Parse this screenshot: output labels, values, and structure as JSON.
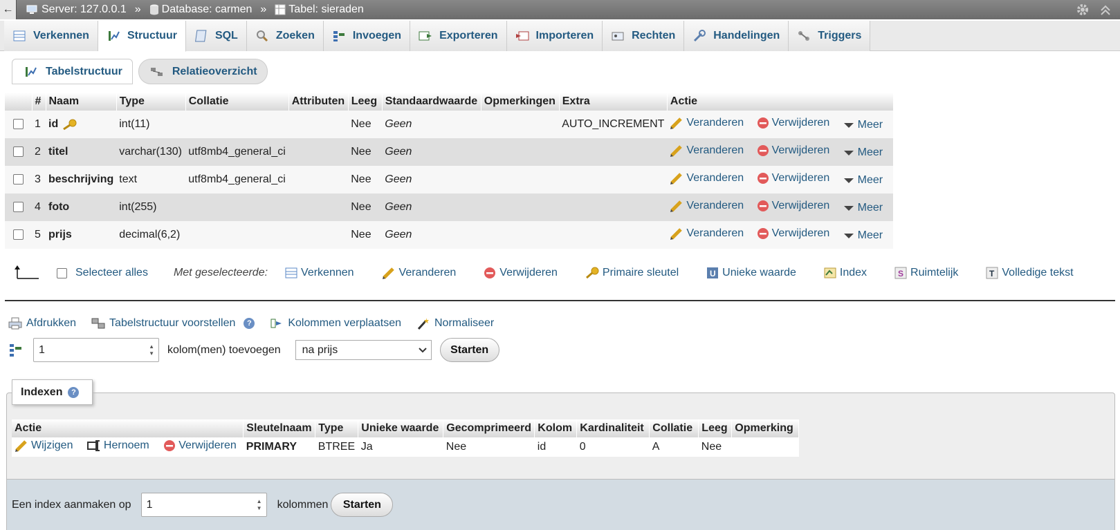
{
  "topbar": {
    "back": "←",
    "server": "Server: 127.0.0.1",
    "database": "Database: carmen",
    "table": "Tabel: sieraden",
    "sep": "»"
  },
  "tabs": [
    {
      "label": "Verkennen",
      "icon": "browse-icon"
    },
    {
      "label": "Structuur",
      "icon": "structure-icon"
    },
    {
      "label": "SQL",
      "icon": "sql-icon"
    },
    {
      "label": "Zoeken",
      "icon": "search-icon"
    },
    {
      "label": "Invoegen",
      "icon": "insert-icon"
    },
    {
      "label": "Exporteren",
      "icon": "export-icon"
    },
    {
      "label": "Importeren",
      "icon": "import-icon"
    },
    {
      "label": "Rechten",
      "icon": "privileges-icon"
    },
    {
      "label": "Handelingen",
      "icon": "wrench-icon"
    },
    {
      "label": "Triggers",
      "icon": "triggers-icon"
    }
  ],
  "subtabs": {
    "table_structure": "Tabelstructuur",
    "relation_view": "Relatieoverzicht"
  },
  "structure": {
    "headers": [
      "#",
      "Naam",
      "Type",
      "Collatie",
      "Attributen",
      "Leeg",
      "Standaardwaarde",
      "Opmerkingen",
      "Extra",
      "Actie"
    ],
    "rows": [
      {
        "num": "1",
        "name": "id",
        "type": "int(11)",
        "collation": "",
        "attributes": "",
        "null": "Nee",
        "default": "Geen",
        "comments": "",
        "extra": "AUTO_INCREMENT"
      },
      {
        "num": "2",
        "name": "titel",
        "type": "varchar(130)",
        "collation": "utf8mb4_general_ci",
        "attributes": "",
        "null": "Nee",
        "default": "Geen",
        "comments": "",
        "extra": ""
      },
      {
        "num": "3",
        "name": "beschrijving",
        "type": "text",
        "collation": "utf8mb4_general_ci",
        "attributes": "",
        "null": "Nee",
        "default": "Geen",
        "comments": "",
        "extra": ""
      },
      {
        "num": "4",
        "name": "foto",
        "type": "int(255)",
        "collation": "",
        "attributes": "",
        "null": "Nee",
        "default": "Geen",
        "comments": "",
        "extra": ""
      },
      {
        "num": "5",
        "name": "prijs",
        "type": "decimal(6,2)",
        "collation": "",
        "attributes": "",
        "null": "Nee",
        "default": "Geen",
        "comments": "",
        "extra": ""
      }
    ],
    "actions": {
      "change": "Veranderen",
      "drop": "Verwijderen",
      "more": "Meer"
    }
  },
  "bulk": {
    "select_all": "Selecteer alles",
    "with_selected": "Met geselecteerde:",
    "browse": "Verkennen",
    "change": "Veranderen",
    "drop": "Verwijderen",
    "primary": "Primaire sleutel",
    "unique": "Unieke waarde",
    "index": "Index",
    "spatial": "Ruimtelijk",
    "fulltext": "Volledige tekst"
  },
  "links": {
    "print": "Afdrukken",
    "propose": "Tabelstructuur voorstellen",
    "move": "Kolommen verplaatsen",
    "normalize": "Normaliseer"
  },
  "add_column": {
    "count": "1",
    "label": "kolom(men) toevoegen",
    "position": "na prijs",
    "go": "Starten"
  },
  "indexes": {
    "legend": "Indexen",
    "headers": [
      "Actie",
      "Sleutelnaam",
      "Type",
      "Unieke waarde",
      "Gecomprimeerd",
      "Kolom",
      "Kardinaliteit",
      "Collatie",
      "Leeg",
      "Opmerking"
    ],
    "row": {
      "edit": "Wijzigen",
      "rename": "Hernoem",
      "drop": "Verwijderen",
      "keyname": "PRIMARY",
      "type": "BTREE",
      "unique": "Ja",
      "packed": "Nee",
      "column": "id",
      "cardinality": "0",
      "collation": "A",
      "null": "Nee",
      "comment": ""
    },
    "create_label": "Een index aanmaken op",
    "create_count": "1",
    "columns_label": "kolommen",
    "go": "Starten"
  }
}
